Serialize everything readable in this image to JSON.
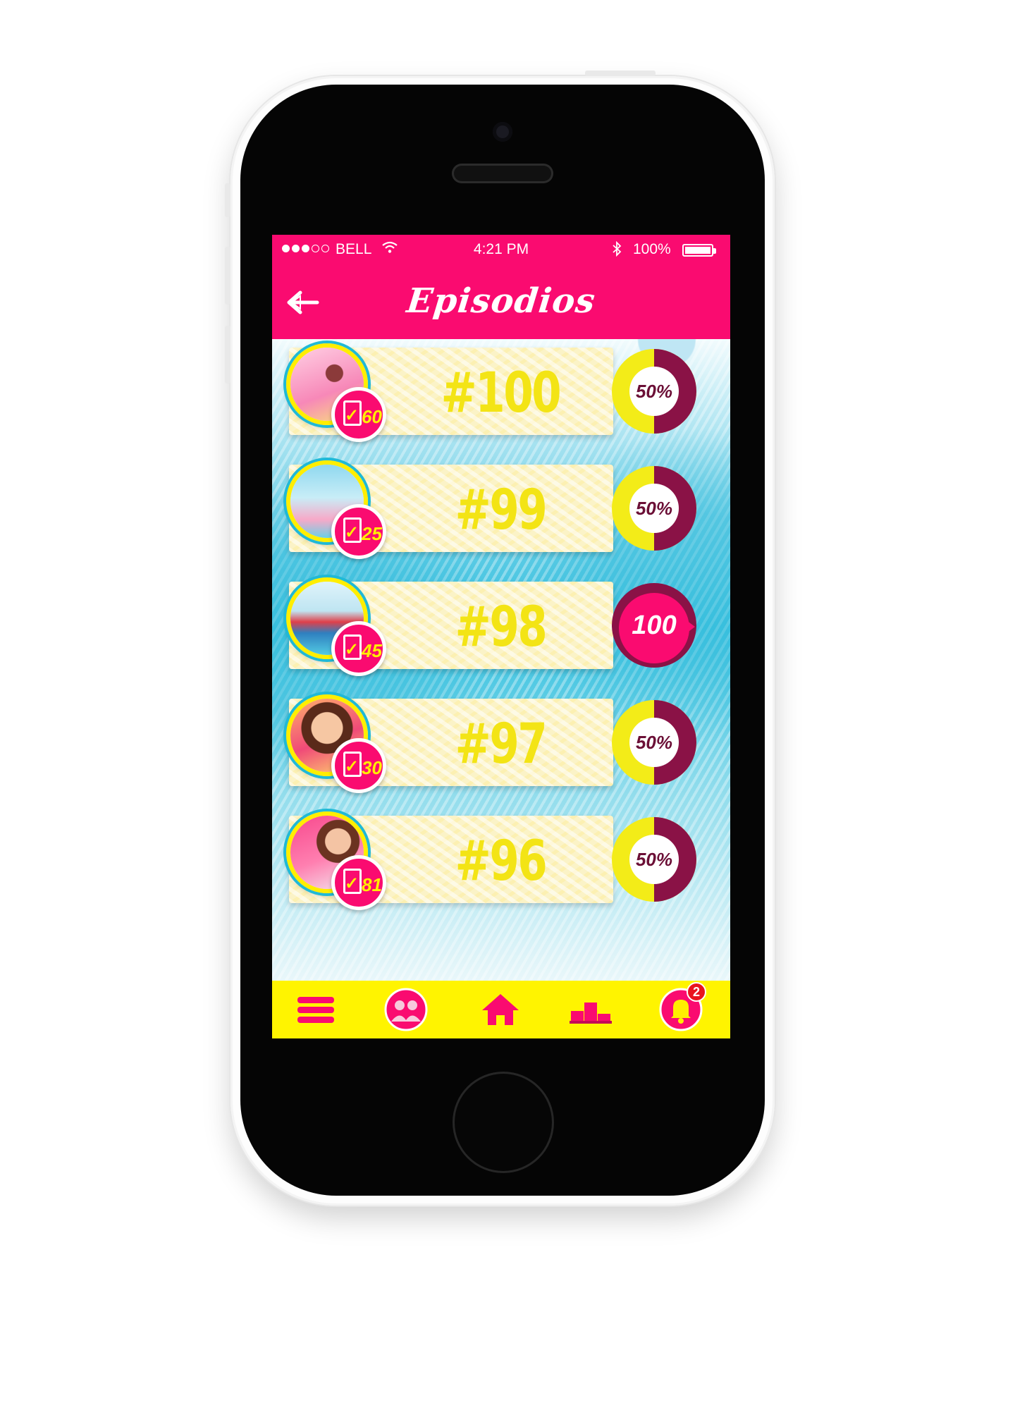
{
  "status_bar": {
    "carrier": "BELL",
    "time": "4:21 PM",
    "battery": "100%"
  },
  "header": {
    "title": "Episodios",
    "back_icon": "back-arrow-icon"
  },
  "episodes": [
    {
      "number": "#100",
      "points": "60",
      "progress": "50%",
      "progress_value": 0.5,
      "complete": false
    },
    {
      "number": "#99",
      "points": "25",
      "progress": "50%",
      "progress_value": 0.5,
      "complete": false
    },
    {
      "number": "#98",
      "points": "45",
      "progress": "100",
      "progress_value": 1.0,
      "complete": true
    },
    {
      "number": "#97",
      "points": "30",
      "progress": "50%",
      "progress_value": 0.5,
      "complete": false
    },
    {
      "number": "#96",
      "points": "81",
      "progress": "50%",
      "progress_value": 0.5,
      "complete": false
    }
  ],
  "tabbar": {
    "items": [
      {
        "icon": "menu-icon"
      },
      {
        "icon": "friends-icon"
      },
      {
        "icon": "home-icon"
      },
      {
        "icon": "ranking-podium-icon"
      },
      {
        "icon": "bell-icon",
        "badge": "2"
      }
    ]
  },
  "colors": {
    "brand_pink": "#fa0b70",
    "brand_yellow": "#fff400",
    "ring_maroon": "#8a1246",
    "accent_cyan": "#20b9d6"
  }
}
